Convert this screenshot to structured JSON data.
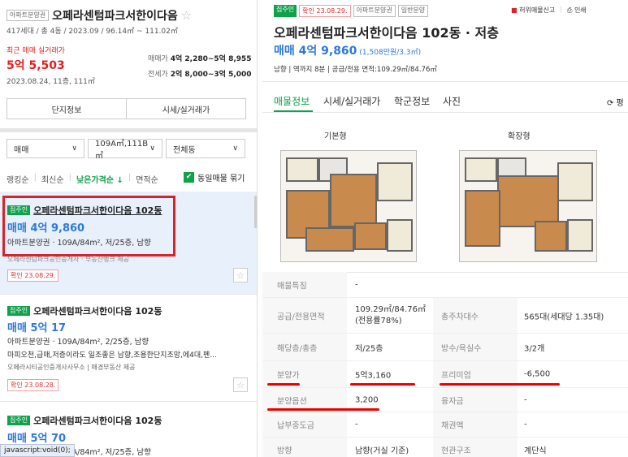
{
  "complex": {
    "type_tag": "아파트분양권",
    "name": "오페라센텀파크서한이다음",
    "star": "☆",
    "meta": "417세대 / 총 4동 / 2023.09 / 96.14㎡ ~ 111.02㎡",
    "recent_label": "최근 매매 실거래가",
    "recent_price": "5억 5,503",
    "recent_date": "2023.08.24, 11층, 111㎡",
    "sale_range_label": "매매가",
    "sale_range": "4억 2,280~5억 8,955",
    "jeonse_range_label": "전세가",
    "jeonse_range": "2억 8,000~3억 5,000",
    "btn_info": "단지정보",
    "btn_price": "시세/실거래가"
  },
  "filters": {
    "trade": "매매",
    "area": "109A㎡,111B㎡",
    "dong": "전체동",
    "sort_ranking": "랭킹순",
    "sort_latest": "최신순",
    "sort_lowprice": "낮은가격순 ↓",
    "sort_area": "면적순",
    "group_label": "동일매물 묶기"
  },
  "listings": [
    {
      "tag": "집주인",
      "title": "오페라센텀파크서한이다음 102동",
      "price": "매매 4억 9,860",
      "desc": "아파트분양권 · 109A/84m², 저/25층, 남향",
      "desc2": "오페라센텀파크공인중개사 · 부동산뱅크 제공",
      "confirm": "확인 23.08.29."
    },
    {
      "tag": "집주인",
      "title": "오페라센텀파크서한이다음 102동",
      "price": "매매 5억 17",
      "desc": "아파트분양권 · 109A/84m², 2/25층, 남향",
      "desc2": "마피오천,급매,저층이라도 일조좋은 남향,조용한단지조망,에4대,펜...",
      "desc3": "오페라시티공인중개사사무소 | 매경부동산 제공",
      "confirm": "확인 23.08.28."
    },
    {
      "tag": "집주인",
      "title": "오페라센텀파크서한이다음 102동",
      "price": "매매 5억 70",
      "desc": "아파트분양권 · 109A/84m², 저/25층, 남향"
    }
  ],
  "statusbar": "javascript:void(0);",
  "detail": {
    "tag_owner": "집주인",
    "tag_confirm": "확인 23.08.29.",
    "tag_type": "아파트분양권",
    "tag_general": "일반분양",
    "report_link": "허위매물신고",
    "print_link": "인쇄",
    "title": "오페라센텀파크서한이다음 102동 · 저층",
    "price": "매매 4억 9,860",
    "price_per": "(1,508만원/3.3㎡)",
    "summary": "남향 | 역까지 8분 | 공급/전용 면적:109.29㎡/84.76㎡",
    "tabs": [
      "매물정보",
      "시세/실거래가",
      "학군정보",
      "사진"
    ],
    "tab_refresh": "⟳ 평",
    "plan_basic": "기본형",
    "plan_ext": "확장형",
    "rows": [
      {
        "l1": "매물특징",
        "v1": "-"
      },
      {
        "l1": "공급/전용면적",
        "v1": "109.29㎡/84.76㎡(전용률78%)",
        "l2": "총주차대수",
        "v2": "565대(세대당 1.35대)"
      },
      {
        "l1": "해당층/총층",
        "v1": "저/25층",
        "l2": "방수/욕실수",
        "v2": "3/2개"
      },
      {
        "l1": "분양가",
        "v1": "5억3,160",
        "l2": "프리미엄",
        "v2": "-6,500"
      },
      {
        "l1": "분양옵션",
        "v1": "3,200",
        "l2": "융자금",
        "v2": "-"
      },
      {
        "l1": "납부중도금",
        "v1": "-",
        "l2": "채권액",
        "v2": "-"
      },
      {
        "l1": "방향",
        "v1": "남향(거실 기준)",
        "l2": "현관구조",
        "v2": "계단식"
      }
    ]
  },
  "colors": {
    "green": "#10a14b",
    "blue": "#2f78d8",
    "red": "#e02020"
  }
}
